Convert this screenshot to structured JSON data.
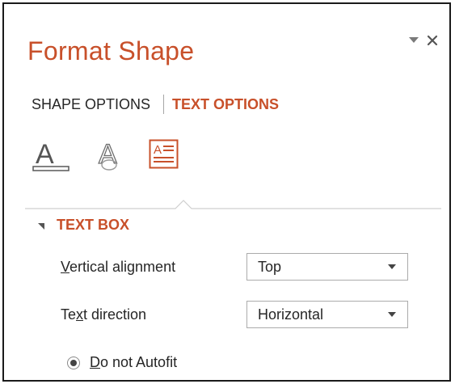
{
  "pane": {
    "title": "Format Shape",
    "controls": {
      "menu_icon": "dropdown-triangle",
      "close_icon": "close-x"
    }
  },
  "tabs": [
    {
      "label": "SHAPE OPTIONS",
      "active": false
    },
    {
      "label": "TEXT OPTIONS",
      "active": true
    }
  ],
  "icon_tabs": [
    {
      "name": "text-fill-outline-icon",
      "selected": false
    },
    {
      "name": "text-effects-icon",
      "selected": false
    },
    {
      "name": "textbox-layout-icon",
      "selected": true
    }
  ],
  "section": {
    "label": "TEXT BOX",
    "expanded": true,
    "vertical_alignment": {
      "label_prefix": "",
      "label_mnemonic": "V",
      "label_rest": "ertical alignment",
      "value": "Top"
    },
    "text_direction": {
      "label_prefix": "Te",
      "label_mnemonic": "x",
      "label_rest": "t direction",
      "value": "Horizontal"
    },
    "autofit": {
      "label_mnemonic": "D",
      "label_rest": "o not Autofit",
      "selected": true
    }
  },
  "colors": {
    "accent": "#c8502a",
    "text": "#262626",
    "border": "#1a1a1a"
  }
}
